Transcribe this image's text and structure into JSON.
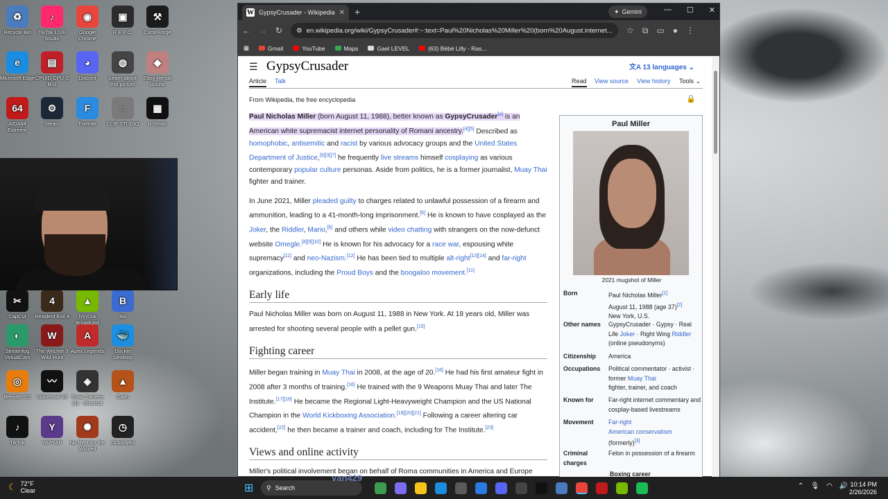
{
  "desktop": {
    "icons": [
      {
        "label": "Recycle Bin",
        "color": "#4a7bbf",
        "glyph": "♻"
      },
      {
        "label": "TikTok LIVE Studio",
        "color": "#ff2a6d",
        "glyph": "♪"
      },
      {
        "label": "Google Chrome",
        "color": "#e8453c",
        "glyph": "◉"
      },
      {
        "label": "R.E.P.O.",
        "color": "#2c2c2c",
        "glyph": "▣"
      },
      {
        "label": "CurseForge",
        "color": "#1b1b1b",
        "glyph": "⚒"
      },
      {
        "label": "Microsoft Edge",
        "color": "#1b8de0",
        "glyph": "e"
      },
      {
        "label": "CPUID CPU-Z MSI",
        "color": "#c0202a",
        "glyph": "▤"
      },
      {
        "label": "Discord",
        "color": "#5865f2",
        "glyph": "◕"
      },
      {
        "label": "Learn about this picture",
        "color": "#444",
        "glyph": "◍"
      },
      {
        "label": "Easy Hentai puzzle",
        "color": "#c08080",
        "glyph": "◆"
      },
      {
        "label": "AIDA64 Extreme",
        "color": "#c01a1a",
        "glyph": "64"
      },
      {
        "label": "Steam",
        "color": "#1b2838",
        "glyph": "⚙"
      },
      {
        "label": "Fortnite",
        "color": "#2a8be0",
        "glyph": "F"
      },
      {
        "label": "CLIP STUDIO",
        "color": "#7a7a7a",
        "glyph": "◌"
      },
      {
        "label": "It Steals",
        "color": "#111",
        "glyph": "▦"
      },
      {
        "label": "CapCut",
        "color": "#111",
        "glyph": "✂"
      },
      {
        "label": "Resident Evil 4",
        "color": "#3a2a1a",
        "glyph": "4"
      },
      {
        "label": "NVIDIA Broadcast",
        "color": "#76b900",
        "glyph": "▲"
      },
      {
        "label": "BA",
        "color": "#3b6ad0",
        "glyph": "B"
      },
      {
        "label": "Streamfog VirtualCam",
        "color": "#2b9a6a",
        "glyph": "◐"
      },
      {
        "label": "The Witcher 3 Wild Hunt",
        "color": "#8a1a1a",
        "glyph": "W"
      },
      {
        "label": "Apex Legends",
        "color": "#c02a2a",
        "glyph": "A"
      },
      {
        "label": "Docker Desktop",
        "color": "#1d8fe0",
        "glyph": "🐳"
      },
      {
        "label": "Blender 5.0",
        "color": "#e87d0d",
        "glyph": "◎"
      },
      {
        "label": "Voicemod V3",
        "color": "#111",
        "glyph": "〰"
      },
      {
        "label": "Snap Camera (1) - Shortcut",
        "color": "#333",
        "glyph": "◈"
      },
      {
        "label": "Cairn",
        "color": "#b4521a",
        "glyph": "▲"
      },
      {
        "label": "TikTok",
        "color": "#111",
        "glyph": "♪"
      },
      {
        "label": "YAPYAP",
        "color": "#5a3a8a",
        "glyph": "Y"
      },
      {
        "label": "No Rest for the Wicked",
        "color": "#a03a1a",
        "glyph": "✺"
      },
      {
        "label": "Outplayed",
        "color": "#222",
        "glyph": "◷"
      }
    ]
  },
  "browser": {
    "tab_title": "GypsyCrusader - Wikipedia",
    "tab_favicon": "W",
    "gemini": "Gemini",
    "url": "en.wikipedia.org/wiki/GypsyCrusader#:~:text=Paul%20Nicholas%20Miller%20(born%20August.internet...",
    "bookmarks": [
      "Gmail",
      "YouTube",
      "Maps",
      "Gael LEVEL",
      "(63) Bébé Lilly - Ras..."
    ]
  },
  "wiki": {
    "title": "GypsyCrusader",
    "languages": "13 languages",
    "tab_article": "Article",
    "tab_talk": "Talk",
    "tab_read": "Read",
    "tab_source": "View source",
    "tab_history": "View history",
    "tab_tools": "Tools",
    "from": "From Wikipedia, the free encyclopedia",
    "p1a": "Paul Nicholas Miller",
    "p1b": " (born August 11, 1988), better known as ",
    "p1c": "GypsyCrusader",
    "p1d": "is an American white supremacist internet personality of Romani ancestry.",
    "p1e": " Described as ",
    "p1f": "homophobic",
    "p1g": "antisemitic",
    "p1h": " and ",
    "p1i": "racist",
    "p1j": " by various advocacy groups and the ",
    "p1k": "United States Department of Justice",
    "p1l": " he frequently ",
    "p1m": "live streams",
    "p1n": " himself ",
    "p1o": "cosplaying",
    "p1p": " as various contemporary ",
    "p1q": "popular culture",
    "p1r": " personas. Aside from politics, he is a former journalist, ",
    "p1s": "Muay Thai",
    "p1t": " fighter and trainer.",
    "p2": "In June 2021, Miller",
    "p2b": "pleaded guilty",
    "p2c": " to charges related to unlawful possession of a firearm and ammunition, leading to a 41-month-long imprisonment.",
    "p2d": " He is known to have cosplayed as the ",
    "p2e": "Joker",
    "p2f": ", the ",
    "p2g": "Riddler",
    "p2h": "Mario",
    "p2i": " and others while ",
    "p2j": "video chatting",
    "p2k": " with strangers on the now-defunct website ",
    "p2l": "Omegle.",
    "p2m": " He is known for his advocacy for a ",
    "p2n": "race war",
    "p2o": ", espousing white supremacy",
    "p2p": " and ",
    "p2q": "neo-Nazism.",
    "p2r": " He has been tied to multiple ",
    "p2s": "alt-right",
    "p2t": " and ",
    "p2u": "far-right",
    "p2v": " organizations, including the ",
    "p2w": "Proud Boys",
    "p2x": " and the ",
    "p2y": "boogaloo movement.",
    "h_early": "Early life",
    "p3": "Paul Nicholas Miller was born on August 11, 1988 in New York. At 18 years old, Miller was arrested for shooting several people with a pellet gun.",
    "h_fight": "Fighting career",
    "p4a": "Miller began training in ",
    "p4b": "Muay Thai",
    "p4c": " in 2008, at the age of 20.",
    "p4d": " He had his first amateur fight in 2008 after 3 months of training.",
    "p4e": " He trained with the 9 Weapons Muay Thai and later The Institute.",
    "p4f": " He became the Regional Light-Heavyweight Champion and the US National Champion in the ",
    "p4g": "World Kickboxing Association.",
    "p4h": " Following a career altering car accident,",
    "p4i": " he then became a trainer and coach, including for The Institute.",
    "h_views": "Views and online activity",
    "p5": "Miller's political involvement began on behalf of Roma communities in America and Europe",
    "info_name": "Paul Miller",
    "info_caption": "2021 mugshot of Miller",
    "born_k": "Born",
    "born_v1": "Paul Nicholas Miller",
    "born_v2": "August 11, 1988 (age 37)",
    "born_v3": "New York, U.S.",
    "other_k": "Other names",
    "other_v": "GypsyCrusader · Gypsy · Real Life ",
    "other_joker": "Joker",
    "other_v2": " · Right Wing ",
    "other_riddler": "Riddler",
    "other_v3": "(online pseudonyms)",
    "cit_k": "Citizenship",
    "cit_v": "America",
    "occ_k": "Occupations",
    "occ_v": "Political commentator · activist · former ",
    "occ_mt": "Muay Thai",
    "occ_v2": "fighter, trainer, and coach",
    "known_k": "Known for",
    "known_v": "Far-right internet commentary and cosplay-based livestreams",
    "mov_k": "Movement",
    "mov_v1": "Far-right",
    "mov_v2": "American conservatism",
    "mov_v3": "(formerly)",
    "crim_k": "Criminal charges",
    "crim_v": "Felon in possession of a firearm",
    "boxing": "Boxing career"
  },
  "taskbar": {
    "weather_temp": "72°F",
    "weather_desc": "Clear",
    "search": "Search",
    "watermark": "van429",
    "time": "10:14 PM",
    "date": "2/26/2026"
  },
  "colors": {
    "link": "#3366cc",
    "highlight": "#e8d8f7"
  }
}
